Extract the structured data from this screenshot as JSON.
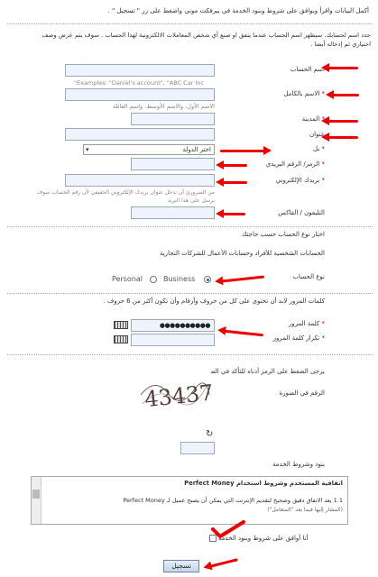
{
  "intro": "أكمل البيانات واقرأ ويوافق على شروط وبنود الخدمة في بيرفكت موني واضغط على زر \" تسجيل \" .",
  "account_note_line1": "حدد اسم لحسابك. سيظهر اسم الحساب عندما يتفق او صنع أي شخص المعاملات الالكترونية لهذا الحساب . سوف يتم عرض وصف",
  "account_note_line2": "اختياري ثم إدخاله أيضا .",
  "fields": {
    "account_name": {
      "label": "اسم الحساب",
      "placeholder": "\"Examples: \"Daniel's account\", \"ABC Car Inc"
    },
    "full_name": {
      "label": "الاسم بالكامل",
      "hint": "الاسم الأول، والاسم الأوسط، واسم العائلة"
    },
    "city": {
      "label": "المدينة"
    },
    "address": {
      "label": "عنوان"
    },
    "country": {
      "label": "بل",
      "value": "اختر الدولة"
    },
    "zip": {
      "label": "الرمز/ الرقم البريدي"
    },
    "email": {
      "label": "بريدك الإلكتروني",
      "hint_line1": "من الضروري أن تدخل عنوان بريدك الإلكتروني الحقيقي لأن رقم الحساب سوف",
      "hint_line2": "يرسل على هذا البريد"
    },
    "phone": {
      "label": "التليفون / الفاكس"
    }
  },
  "account_type": {
    "heading": "اختار نوع الحساب حسب حاجتك",
    "desc": "الحسابات الشخصية للأفراد وحسابات الأعمال للشركات التجارية",
    "label": "نوع الحساب",
    "personal": "Personal",
    "business": "Business",
    "selected": "Business"
  },
  "password": {
    "rule": "كلمات المرور لابد أن تحتوي على كل من حروف وأرقام وأن تكون أكثر من 6 حروف .",
    "label": "كلمة المرور",
    "value": "●●●●●●●●●●",
    "confirm_label": "تكرار كلمة المرور"
  },
  "captcha": {
    "prompt": "يرجى الضغط على الرمز أدناه للتأكد في الصورة",
    "label": "الرقم في الصورة",
    "image_text": "43437",
    "refresh": "↻"
  },
  "terms": {
    "heading": "بنود وشروط الخدمة",
    "box_title": "اتفاقية المستخدم وشروط استخدام Perfect Money",
    "line1": "1.1 يعد الاتفاق دقيق وصحيح لتقديم الإنترنت التي يمكن أن يصبح عميل لـ Perfect Money",
    "line2": "(المشار إليها فيما بعد \"المتعامل\")",
    "agree": "أنا أوافق على شروط وبنود الخدمة"
  },
  "submit": "تسجيل",
  "colors": {
    "arrow": "#e00000",
    "input_bg": "#eef4ff",
    "required": "#cc0000"
  }
}
